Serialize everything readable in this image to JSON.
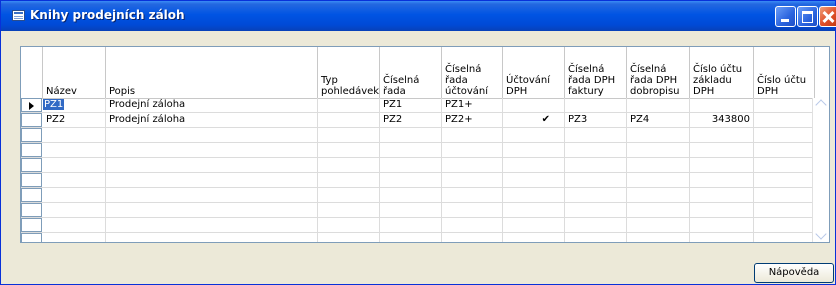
{
  "window": {
    "title": "Knihy prodejních záloh"
  },
  "columns": [
    {
      "label": "Název"
    },
    {
      "label": "Popis"
    },
    {
      "label": "Typ\npohledávek"
    },
    {
      "label": "Číselná\nřada"
    },
    {
      "label": "Číselná\nřada\núčtování"
    },
    {
      "label": "Účtování\nDPH"
    },
    {
      "label": "Číselná\nřada DPH\nfaktury"
    },
    {
      "label": "Číselná\nřada DPH\ndobropisu"
    },
    {
      "label": "Číslo účtu\nzákladu\nDPH"
    },
    {
      "label": "Číslo účtu\nDPH"
    }
  ],
  "rows": [
    {
      "nazev": "PZ1",
      "popis": "Prodejní záloha",
      "typ": "",
      "rada": "PZ1",
      "rada_uct": "PZ1+",
      "uct_dph": "",
      "rada_fakt": "",
      "rada_dobr": "",
      "ucet_zakl": "",
      "ucet_dph": ""
    },
    {
      "nazev": "PZ2",
      "popis": "Prodejní záloha",
      "typ": "",
      "rada": "PZ2",
      "rada_uct": "PZ2+",
      "uct_dph": "✔",
      "rada_fakt": "PZ3",
      "rada_dobr": "PZ4",
      "ucet_zakl": "343800",
      "ucet_dph": ""
    }
  ],
  "buttons": {
    "help": "Nápověda"
  },
  "colors": {
    "titlebar": "#0054e3",
    "selection": "#316ac5",
    "window_bg": "#ece9d8"
  },
  "icons": {
    "window": "table-icon",
    "row_pointer": "arrow-right-icon"
  }
}
